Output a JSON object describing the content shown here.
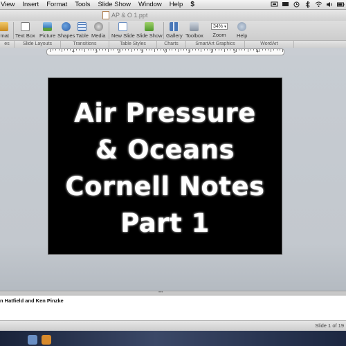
{
  "menubar": {
    "items": [
      "View",
      "Insert",
      "Format",
      "Tools",
      "Slide Show",
      "Window",
      "Help"
    ],
    "script_menu": "$"
  },
  "window": {
    "document_title": "AP & O 1.ppt"
  },
  "toolbar": {
    "items": [
      {
        "label": "rmat",
        "icon": "format-icon"
      },
      {
        "label": "Text Box",
        "icon": "text-box-icon"
      },
      {
        "label": "Picture",
        "icon": "picture-icon"
      },
      {
        "label": "Shapes",
        "icon": "shapes-icon"
      },
      {
        "label": "Table",
        "icon": "table-icon"
      },
      {
        "label": "Media",
        "icon": "media-icon"
      },
      {
        "label": "New Slide",
        "icon": "new-slide-icon"
      },
      {
        "label": "Slide Show",
        "icon": "slide-show-icon"
      },
      {
        "label": "Gallery",
        "icon": "gallery-icon"
      },
      {
        "label": "Toolbox",
        "icon": "toolbox-icon"
      },
      {
        "label": "Zoom",
        "icon": "zoom-field"
      },
      {
        "label": "Help",
        "icon": "help-icon"
      }
    ],
    "zoom_value": "34%"
  },
  "ribbon": {
    "tabs": [
      "es",
      "Slide Layouts",
      "Transitions",
      "Table Styles",
      "Charts",
      "SmartArt Graphics",
      "WordArt"
    ]
  },
  "ruler": {
    "labels": [
      "4",
      "3",
      "2",
      "1",
      "0",
      "1",
      "2",
      "3",
      "4"
    ]
  },
  "slide": {
    "title_lines": [
      "Air Pressure",
      "& Oceans",
      "Cornell Notes",
      "Part 1"
    ]
  },
  "notes": {
    "text": "n Hatfield and Ken Pinzke"
  },
  "status": {
    "slide_indicator": "Slide 1 of 19"
  },
  "colors": {
    "slide_background": "#000000",
    "slide_text": "#ffffff",
    "canvas_background": "#c7ccd2"
  }
}
